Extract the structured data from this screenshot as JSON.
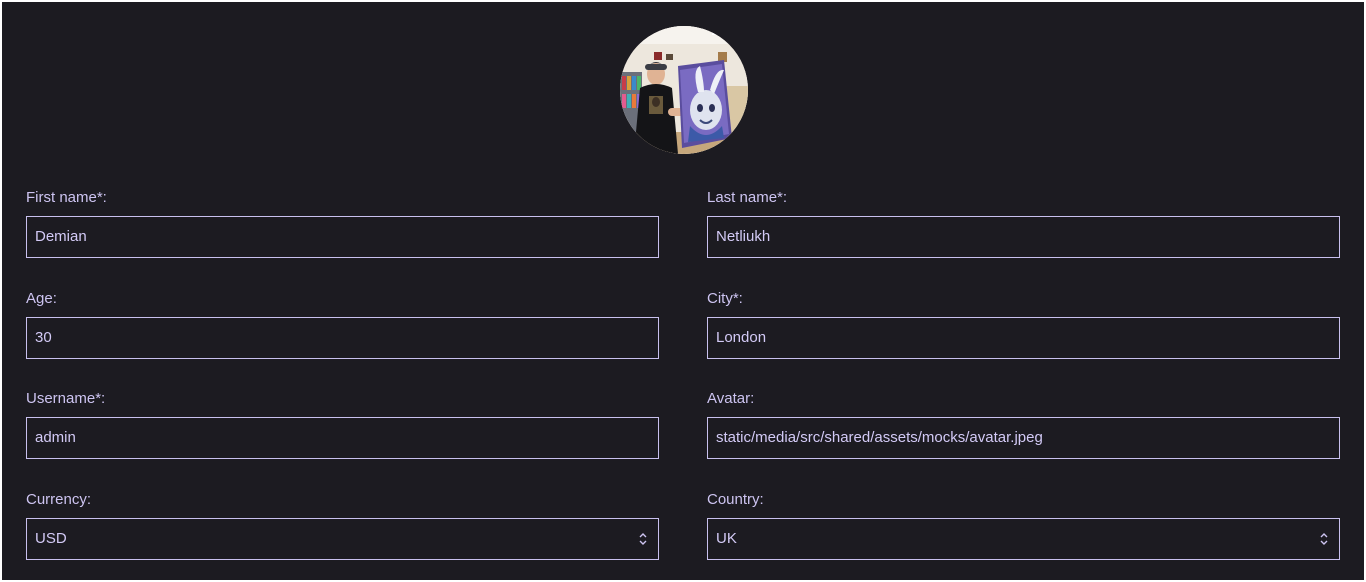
{
  "profile": {
    "avatar_alt": "avatar"
  },
  "form": {
    "first_name": {
      "label": "First name*:",
      "value": "Demian"
    },
    "last_name": {
      "label": "Last name*:",
      "value": "Netliukh"
    },
    "age": {
      "label": "Age:",
      "value": "30"
    },
    "city": {
      "label": "City*:",
      "value": "London"
    },
    "username": {
      "label": "Username*:",
      "value": "admin"
    },
    "avatar": {
      "label": "Avatar:",
      "value": "static/media/src/shared/assets/mocks/avatar.jpeg"
    },
    "currency": {
      "label": "Currency:",
      "selected": "USD"
    },
    "country": {
      "label": "Country:",
      "selected": "UK"
    }
  },
  "colors": {
    "background": "#1c1b21",
    "text": "#cdc4f1",
    "border": "#c8c0ee"
  },
  "icons": {
    "select_arrow": "updown-chevron-icon"
  }
}
